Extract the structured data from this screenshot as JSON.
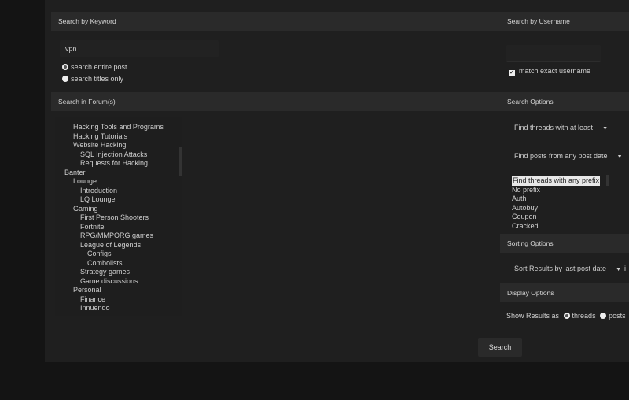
{
  "keyword": {
    "header": "Search by Keyword",
    "value": "vpn",
    "radio_entire": "search entire post",
    "radio_titles": "search titles only"
  },
  "username": {
    "header": "Search by Username",
    "value": "",
    "match_exact": "match exact username"
  },
  "forums": {
    "header": "Search in Forum(s)",
    "items": [
      {
        "label": "Hacking Tools and Programs",
        "level": 1
      },
      {
        "label": "Hacking Tutorials",
        "level": 1
      },
      {
        "label": "Website Hacking",
        "level": 1
      },
      {
        "label": "SQL Injection Attacks",
        "level": 2
      },
      {
        "label": "Requests for Hacking",
        "level": 2
      },
      {
        "label": "Banter",
        "level": 0
      },
      {
        "label": "Lounge",
        "level": 1
      },
      {
        "label": "Introduction",
        "level": 2
      },
      {
        "label": "LQ Lounge",
        "level": 2
      },
      {
        "label": "Gaming",
        "level": 1
      },
      {
        "label": "First Person Shooters",
        "level": 2
      },
      {
        "label": "Fortnite",
        "level": 2
      },
      {
        "label": "RPG/MMPORG games",
        "level": 2
      },
      {
        "label": "League of Legends",
        "level": 2
      },
      {
        "label": "Configs",
        "level": 3
      },
      {
        "label": "Combolists",
        "level": 3
      },
      {
        "label": "Strategy games",
        "level": 2
      },
      {
        "label": "Game discussions",
        "level": 2
      },
      {
        "label": "Personal",
        "level": 1
      },
      {
        "label": "Finance",
        "level": 2
      },
      {
        "label": "Innuendo",
        "level": 2
      }
    ]
  },
  "options": {
    "header": "Search Options",
    "threads_select": "Find threads with at least",
    "date_select": "Find posts from any post date",
    "prefixes": [
      "Find threads with any prefix",
      "No prefix",
      "Auth",
      "Autobuy",
      "Coupon",
      "Cracked"
    ]
  },
  "sorting": {
    "header": "Sorting Options",
    "sort_select": "Sort Results by last post date",
    "trailing": "i"
  },
  "display": {
    "header": "Display Options",
    "label": "Show Results as",
    "threads": "threads",
    "posts": "posts"
  },
  "search_button": "Search"
}
